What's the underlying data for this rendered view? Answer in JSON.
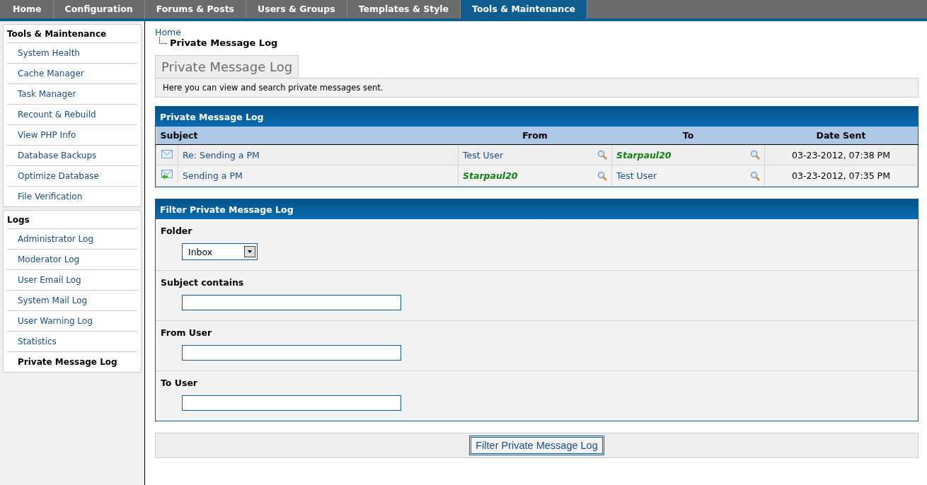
{
  "nav_tabs": [
    {
      "label": "Home",
      "selected": false
    },
    {
      "label": "Configuration",
      "selected": false
    },
    {
      "label": "Forums & Posts",
      "selected": false
    },
    {
      "label": "Users & Groups",
      "selected": false
    },
    {
      "label": "Templates & Style",
      "selected": false
    },
    {
      "label": "Tools & Maintenance",
      "selected": true
    }
  ],
  "sidebar": [
    {
      "title": "Tools & Maintenance",
      "items": [
        {
          "label": "System Health",
          "selected": false
        },
        {
          "label": "Cache Manager",
          "selected": false
        },
        {
          "label": "Task Manager",
          "selected": false
        },
        {
          "label": "Recount & Rebuild",
          "selected": false
        },
        {
          "label": "View PHP Info",
          "selected": false
        },
        {
          "label": "Database Backups",
          "selected": false
        },
        {
          "label": "Optimize Database",
          "selected": false
        },
        {
          "label": "File Verification",
          "selected": false
        }
      ]
    },
    {
      "title": "Logs",
      "items": [
        {
          "label": "Administrator Log",
          "selected": false
        },
        {
          "label": "Moderator Log",
          "selected": false
        },
        {
          "label": "User Email Log",
          "selected": false
        },
        {
          "label": "System Mail Log",
          "selected": false
        },
        {
          "label": "User Warning Log",
          "selected": false
        },
        {
          "label": "Statistics",
          "selected": false
        },
        {
          "label": "Private Message Log",
          "selected": true
        }
      ]
    }
  ],
  "breadcrumb": {
    "home": "Home",
    "current": "Private Message Log"
  },
  "page_tab": "Private Message Log",
  "description": "Here you can view and search private messages sent.",
  "log_table": {
    "title": "Private Message Log",
    "columns": [
      "Subject",
      "From",
      "To",
      "Date Sent"
    ],
    "rows": [
      {
        "kind": "plain",
        "subject": "Re: Sending a PM",
        "from": {
          "name": "Test User",
          "highlighted": false
        },
        "to": {
          "name": "Starpaul20",
          "highlighted": true
        },
        "date": "03-23-2012, 07:38 PM"
      },
      {
        "kind": "arrow",
        "subject": "Sending a PM",
        "from": {
          "name": "Starpaul20",
          "highlighted": true
        },
        "to": {
          "name": "Test User",
          "highlighted": false
        },
        "date": "03-23-2012, 07:35 PM"
      }
    ]
  },
  "filter": {
    "title": "Filter Private Message Log",
    "fields": [
      {
        "kind": "select",
        "label": "Folder",
        "value": "Inbox"
      },
      {
        "kind": "text",
        "label": "Subject contains"
      },
      {
        "kind": "text",
        "label": "From User"
      },
      {
        "kind": "text",
        "label": "To User"
      }
    ],
    "button": "Filter Private Message Log"
  }
}
